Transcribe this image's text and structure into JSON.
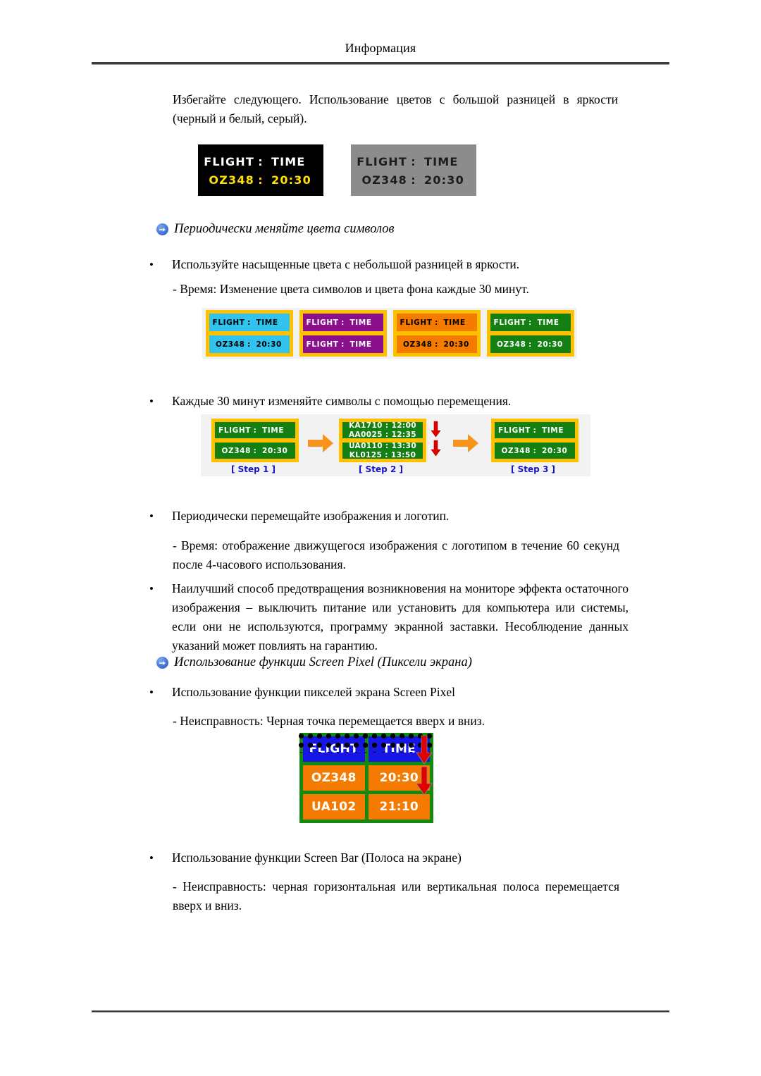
{
  "header": {
    "title": "Информация"
  },
  "intro": {
    "text": "Избегайте следующего. Использование цветов с большой разницей в яркости (черный и белый, серый)."
  },
  "figure_avoid": {
    "panels": [
      {
        "name": "black-panel",
        "background": "#000000",
        "rows": [
          {
            "left": "FLIGHT",
            "sep": ":",
            "right": "TIME",
            "color": "#ffffff"
          },
          {
            "left": "OZ348",
            "sep": ":",
            "right": "20:30",
            "color": "#ffe000"
          }
        ]
      },
      {
        "name": "gray-panel",
        "background": "#8c8c8c",
        "rows": [
          {
            "left": "FLIGHT",
            "sep": ":",
            "right": "TIME",
            "color": "#1c1c1c"
          },
          {
            "left": "OZ348",
            "sep": ":",
            "right": "20:30",
            "color": "#1c1c1c"
          }
        ]
      }
    ]
  },
  "section_colors": {
    "heading": "Периодически меняйте цвета символов",
    "bullet1": "Используйте насыщенные цвета с небольшой разницей в яркости.",
    "note1": "- Время: Изменение цвета символов и цвета фона каждые 30 минут.",
    "bullet2": "Каждые 30 минут изменяйте символы с помощью перемещения.",
    "bullet3": "Периодически перемещайте изображения и логотип.",
    "note2": "- Время: отображение движущегося изображения с логотипом в течение 60 секунд после 4-часового использования.",
    "bullet4": "Наилучший способ предотвращения возникновения на мониторе эффекта остаточного изображения – выключить питание или установить для компьютера или системы, если они не используются, программу экранной заставки. Несоблюдение данных указаний может повлиять на гарантию."
  },
  "figure_colors": {
    "frame_color": "#ffc000",
    "panels": [
      {
        "name": "cyan-panel",
        "background": "#31c3ee",
        "text_color": "#000000",
        "rows": [
          {
            "left": "FLIGHT",
            "sep": ":",
            "right": "TIME"
          },
          {
            "left": "OZ348",
            "sep": ":",
            "right": "20:30"
          }
        ]
      },
      {
        "name": "purple-panel",
        "background": "#8a0f8a",
        "text_color": "#ffffff",
        "rows": [
          {
            "left": "FLIGHT",
            "sep": ":",
            "right": "TIME"
          },
          {
            "left": "FLIGHT",
            "sep": ":",
            "right": "TIME"
          }
        ]
      },
      {
        "name": "orange-panel",
        "background": "#f57b00",
        "text_color": "#000000",
        "rows": [
          {
            "left": "FLIGHT",
            "sep": ":",
            "right": "TIME"
          },
          {
            "left": "OZ348",
            "sep": ":",
            "right": "20:30"
          }
        ]
      },
      {
        "name": "green-panel",
        "background": "#148014",
        "text_color": "#ffffff",
        "rows": [
          {
            "left": "FLIGHT",
            "sep": ":",
            "right": "TIME"
          },
          {
            "left": "OZ348",
            "sep": ":",
            "right": "20:30"
          }
        ]
      }
    ]
  },
  "figure_steps": {
    "frame_color": "#ffc000",
    "panel_color": "#148014",
    "label_color": "#1414c8",
    "steps": [
      {
        "label": "[ Step 1 ]",
        "rows": [
          {
            "left": "FLIGHT",
            "sep": ":",
            "right": "TIME"
          },
          {
            "left": "OZ348",
            "sep": ":",
            "right": "20:30"
          }
        ]
      },
      {
        "label": "[ Step 2 ]",
        "scrolling": true,
        "rows_top": [
          "KA1710 : 12:00",
          "AA0025 : 12:35"
        ],
        "rows_bottom": [
          "UA0110 : 13:30",
          "KL0125 : 13:50"
        ]
      },
      {
        "label": "[ Step 3 ]",
        "rows": [
          {
            "left": "FLIGHT",
            "sep": ":",
            "right": "TIME"
          },
          {
            "left": "OZ348",
            "sep": ":",
            "right": "20:30"
          }
        ]
      }
    ],
    "arrow_color": "#f7941e",
    "red_arrow_color": "#e00000"
  },
  "section_pixel": {
    "heading": "Использование функции Screen Pixel (Пиксели экрана)",
    "bullet1": "Использование функции пикселей экрана Screen Pixel",
    "note1": "- Неисправность: Черная точка перемещается вверх и вниз.",
    "bullet2": "Использование функции Screen Bar (Полоса на экране)",
    "note2": "- Неисправность: черная горизонтальная или вертикальная полоса перемещается вверх и вниз."
  },
  "figure_pixel": {
    "border_color": "#128a12",
    "header_cell_color": "#1616e6",
    "data_cell_color": "#f57b00",
    "arrow_color": "#e00000",
    "rows": [
      {
        "flight": "FLIGHT",
        "time": "TIME",
        "type": "header"
      },
      {
        "flight": "OZ348",
        "time": "20:30",
        "type": "data"
      },
      {
        "flight": "UA102",
        "time": "21:10",
        "type": "data"
      }
    ]
  }
}
